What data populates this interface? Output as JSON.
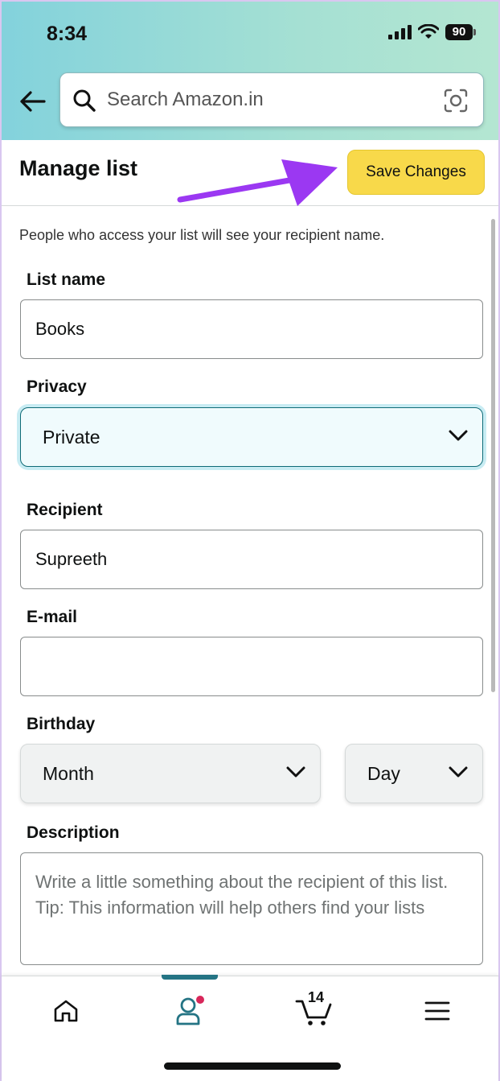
{
  "status_bar": {
    "time": "8:34",
    "battery": "90"
  },
  "search": {
    "placeholder": "Search Amazon.in"
  },
  "header": {
    "title": "Manage list",
    "save_label": "Save Changes"
  },
  "form": {
    "note": "People who access your list will see your recipient name.",
    "list_name_label": "List name",
    "list_name_value": "Books",
    "privacy_label": "Privacy",
    "privacy_value": "Private",
    "recipient_label": "Recipient",
    "recipient_value": "Supreeth",
    "email_label": "E-mail",
    "email_value": "",
    "birthday_label": "Birthday",
    "month_value": "Month",
    "day_value": "Day",
    "description_label": "Description",
    "description_placeholder": "Write a little something about the recipient of this list. Tip: This information will help others find your lists"
  },
  "bottom_nav": {
    "cart_count": "14",
    "items": [
      "home-icon",
      "account-icon",
      "cart-icon",
      "menu-icon"
    ],
    "active": "account-icon"
  },
  "colors": {
    "save_button": "#f8d94a",
    "annotation_arrow": "#9b38f2",
    "accent": "#247484",
    "notification_dot": "#d8275a"
  }
}
